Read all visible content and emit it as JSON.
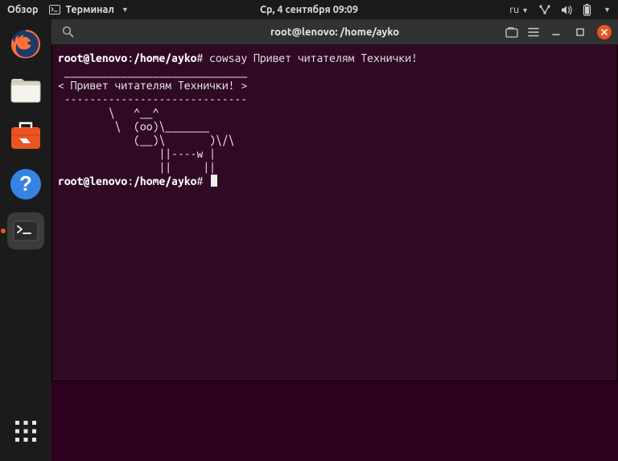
{
  "panel": {
    "overview": "Обзор",
    "active_app": "Терминал",
    "datetime": "Ср, 4 сентября  09:09",
    "input_lang": "ru"
  },
  "launcher": {
    "items": [
      "firefox-icon",
      "files-icon",
      "software-icon",
      "help-icon",
      "terminal-icon"
    ]
  },
  "window": {
    "title": "root@lenovo: /home/ayko"
  },
  "terminal": {
    "prompt_userhost": "root@lenovo",
    "prompt_path": "/home/ayko",
    "prompt_symbol": "#",
    "command": "cowsay Привет читателям Технички!",
    "output": " _____________________________\n< Привет читателям Технички! >\n -----------------------------\n        \\   ^__^\n         \\  (oo)\\_______\n            (__)\\       )\\/\\\n                ||----w |\n                ||     ||"
  }
}
